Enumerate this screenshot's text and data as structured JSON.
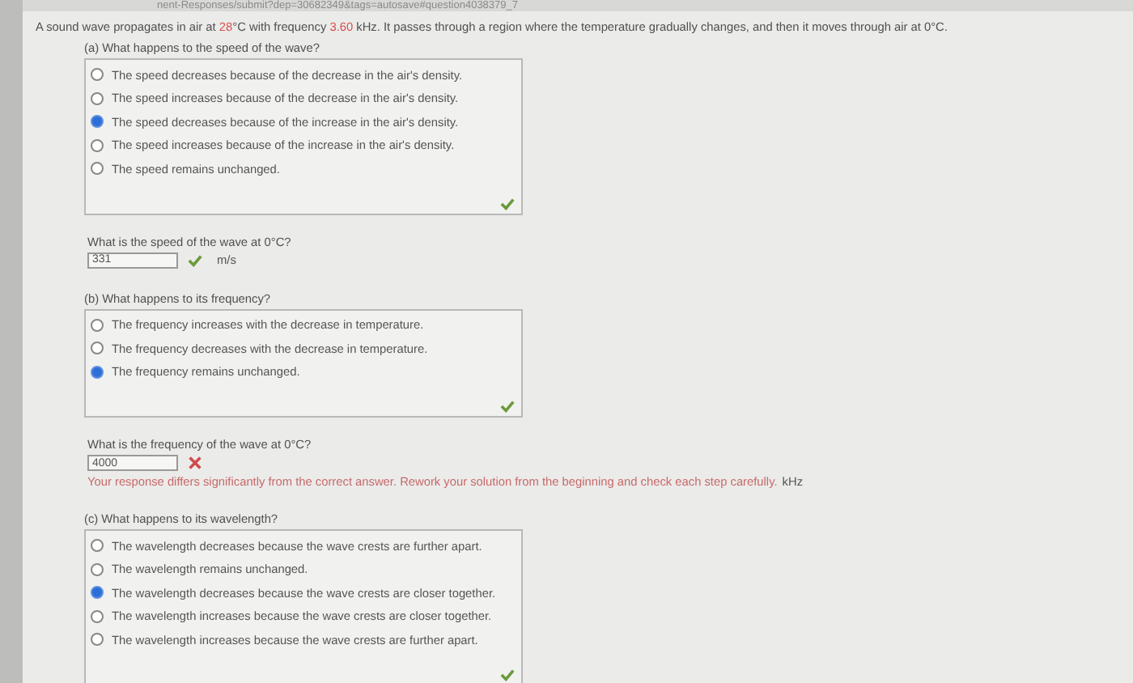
{
  "address_bar": {
    "url": "nent-Responses/submit?dep=30682349&tags=autosave#question4038379_7"
  },
  "intro": [
    {
      "kind": "plain",
      "text": "A sound wave propagates in air at "
    },
    {
      "kind": "given",
      "text": "28"
    },
    {
      "kind": "plain",
      "text": "°C with frequency "
    },
    {
      "kind": "given",
      "text": "3.60"
    },
    {
      "kind": "plain",
      "text": " kHz. It passes through a region where the temperature gradually changes, and then it moves through air at 0°C."
    }
  ],
  "parts": [
    {
      "kind": "choice",
      "question": "(a) What happens to the speed of the wave?",
      "correct": true,
      "options": [
        {
          "text": "The speed decreases because of the decrease in the air's density.",
          "selected": false
        },
        {
          "text": "The speed increases because of the decrease in the air's density.",
          "selected": false
        },
        {
          "text": "The speed decreases because of the increase in the air's density.",
          "selected": true
        },
        {
          "text": "The speed increases because of the increase in the air's density.",
          "selected": false
        },
        {
          "text": "The speed remains unchanged.",
          "selected": false
        }
      ]
    },
    {
      "kind": "numeric",
      "question": "What is the speed of the wave at 0°C?",
      "value": "331",
      "correct": true,
      "unit": "m/s"
    },
    {
      "kind": "choice",
      "question": "(b) What happens to its frequency?",
      "correct": true,
      "options": [
        {
          "text": "The frequency increases with the decrease in temperature.",
          "selected": false
        },
        {
          "text": "The frequency decreases with the decrease in temperature.",
          "selected": false
        },
        {
          "text": "The frequency remains unchanged.",
          "selected": true
        }
      ]
    },
    {
      "kind": "numeric",
      "question": "What is the frequency of the wave at 0°C?",
      "value": "4000",
      "correct": false,
      "feedback": "Your response differs significantly from the correct answer. Rework your solution from the beginning and check each step carefully.",
      "unit": "kHz"
    },
    {
      "kind": "choice",
      "question": "(c) What happens to its wavelength?",
      "correct": true,
      "options": [
        {
          "text": "The wavelength decreases because the wave crests are further apart.",
          "selected": false
        },
        {
          "text": "The wavelength remains unchanged.",
          "selected": false
        },
        {
          "text": "The wavelength decreases because the wave crests are closer together.",
          "selected": true
        },
        {
          "text": "The wavelength increases because the wave crests are closer together.",
          "selected": false
        },
        {
          "text": "The wavelength increases because the wave crests are further apart.",
          "selected": false
        }
      ]
    }
  ]
}
